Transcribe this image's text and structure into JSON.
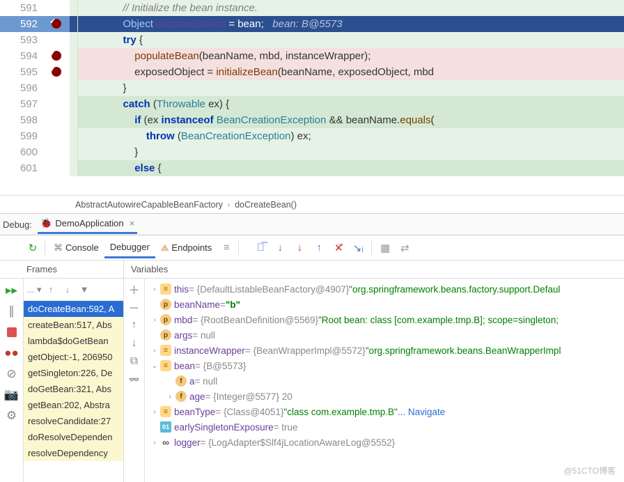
{
  "code": {
    "lines": [
      {
        "num": 591,
        "cls": "bg-greenL",
        "tokens": [
          [
            "               // Initialize the bean instance.",
            "cmt"
          ]
        ]
      },
      {
        "num": 592,
        "cls": "bg-exec bp",
        "tokens": [
          [
            "               ",
            ""
          ],
          [
            "Object",
            "typ"
          ],
          [
            " ",
            ""
          ],
          [
            "exposedObject",
            "id"
          ],
          [
            " = bean;   ",
            ""
          ],
          [
            "bean: B@5573",
            "hint"
          ]
        ]
      },
      {
        "num": 593,
        "cls": "bg-greenL",
        "tokens": [
          [
            "               ",
            ""
          ],
          [
            "try",
            "kw"
          ],
          [
            " {",
            ""
          ]
        ]
      },
      {
        "num": 594,
        "cls": "bg-pink bp",
        "tokens": [
          [
            "                   ",
            ""
          ],
          [
            "populateBean",
            "fn"
          ],
          [
            "(beanName, mbd, instanceWrapper);",
            ""
          ]
        ]
      },
      {
        "num": 595,
        "cls": "bg-pink bp",
        "tokens": [
          [
            "                   exposedObject = ",
            ""
          ],
          [
            "initializeBean",
            "fn"
          ],
          [
            "(beanName, exposedObject, mbd",
            ""
          ]
        ]
      },
      {
        "num": 596,
        "cls": "bg-greenL",
        "tokens": [
          [
            "               }",
            ""
          ]
        ]
      },
      {
        "num": 597,
        "cls": "bg-green",
        "tokens": [
          [
            "               ",
            ""
          ],
          [
            "catch",
            "kw"
          ],
          [
            " (",
            ""
          ],
          [
            "Throwable",
            "typ"
          ],
          [
            " ex) {",
            ""
          ]
        ]
      },
      {
        "num": 598,
        "cls": "bg-green",
        "tokens": [
          [
            "                   ",
            ""
          ],
          [
            "if",
            "kw"
          ],
          [
            " (ex ",
            ""
          ],
          [
            "instanceof",
            "kw"
          ],
          [
            " ",
            ""
          ],
          [
            "BeanCreationException",
            "typ"
          ],
          [
            " && beanName.",
            ""
          ],
          [
            "equals",
            "fn"
          ],
          [
            "(",
            ""
          ]
        ]
      },
      {
        "num": 599,
        "cls": "bg-greenL",
        "tokens": [
          [
            "                       ",
            ""
          ],
          [
            "throw",
            "kw"
          ],
          [
            " (",
            ""
          ],
          [
            "BeanCreationException",
            "typ"
          ],
          [
            ") ex;",
            ""
          ]
        ]
      },
      {
        "num": 600,
        "cls": "bg-greenL",
        "tokens": [
          [
            "                   }",
            ""
          ]
        ]
      },
      {
        "num": 601,
        "cls": "bg-green",
        "tokens": [
          [
            "                   ",
            ""
          ],
          [
            "else",
            "kw"
          ],
          [
            " {",
            ""
          ]
        ]
      }
    ]
  },
  "breadcrumb": {
    "a": "AbstractAutowireCapableBeanFactory",
    "b": "doCreateBean()"
  },
  "debug": {
    "label": "Debug:",
    "tab": "DemoApplication"
  },
  "toolbar": {
    "console": "Console",
    "debugger": "Debugger",
    "endpoints": "Endpoints"
  },
  "panels": {
    "frames": "Frames",
    "variables": "Variables"
  },
  "frames": [
    {
      "label": "doCreateBean:592, A",
      "sel": true
    },
    {
      "label": "createBean:517, Abs",
      "ylw": true
    },
    {
      "label": "lambda$doGetBean",
      "ylw": true
    },
    {
      "label": "getObject:-1, 206950",
      "ylw": true
    },
    {
      "label": "getSingleton:226, De",
      "ylw": true
    },
    {
      "label": "doGetBean:321, Abs",
      "ylw": true
    },
    {
      "label": "getBean:202, Abstra",
      "ylw": true
    },
    {
      "label": "resolveCandidate:27",
      "ylw": true
    },
    {
      "label": "doResolveDependen",
      "ylw": true
    },
    {
      "label": "resolveDependency",
      "ylw": true
    }
  ],
  "vars": [
    {
      "ind": 0,
      "tw": "›",
      "bdg": "eq",
      "name": "this",
      "rest": " = {DefaultListableBeanFactory@4907} ",
      "str": "\"org.springframework.beans.factory.support.Defaul"
    },
    {
      "ind": 0,
      "tw": "",
      "bdg": "p",
      "name": "beanName",
      "rest": " = ",
      "str": "\"b\"",
      "bold": true
    },
    {
      "ind": 0,
      "tw": "›",
      "bdg": "p",
      "name": "mbd",
      "rest": " = {RootBeanDefinition@5569} ",
      "str": "\"Root bean: class [com.example.tmp.B]; scope=singleton;"
    },
    {
      "ind": 0,
      "tw": "",
      "bdg": "p",
      "name": "args",
      "rest": " = null"
    },
    {
      "ind": 0,
      "tw": "›",
      "bdg": "eq",
      "name": "instanceWrapper",
      "rest": " = {BeanWrapperImpl@5572} ",
      "str": "\"org.springframework.beans.BeanWrapperImpl"
    },
    {
      "ind": 0,
      "tw": "⌄",
      "bdg": "eq",
      "name": "bean",
      "rest": " = {B@5573}"
    },
    {
      "ind": 1,
      "tw": "",
      "bdg": "f",
      "name": "a",
      "rest": " = null"
    },
    {
      "ind": 1,
      "tw": "›",
      "bdg": "f",
      "name": "age",
      "rest": " = {Integer@5577} 20"
    },
    {
      "ind": 0,
      "tw": "›",
      "bdg": "eq",
      "name": "beanType",
      "rest": " = {Class@4051} ",
      "str": "\"class com.example.tmp.B\"",
      "link": " ... Navigate"
    },
    {
      "ind": 0,
      "tw": "",
      "bdg": "sq",
      "btxt": "01",
      "name": "earlySingletonExposure",
      "rest": " = true"
    },
    {
      "ind": 0,
      "tw": "›",
      "bdg": "loop",
      "btxt": "∞",
      "name": "logger",
      "rest": " = {LogAdapter$Slf4jLocationAwareLog@5552}"
    }
  ],
  "watermark": "@51CTO博客"
}
